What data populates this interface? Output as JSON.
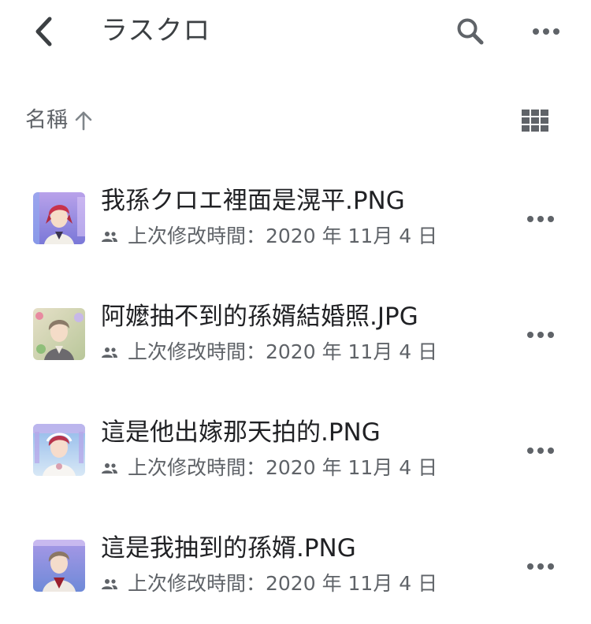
{
  "header": {
    "title": "ラスクロ",
    "back_icon": "back-arrow-icon",
    "search_icon": "search-icon",
    "more_icon": "more-horizontal-icon"
  },
  "sort": {
    "label": "名稱",
    "direction": "ascending",
    "arrow_icon": "arrow-up-icon",
    "view_icon": "grid-view-icon"
  },
  "colors": {
    "icon": "#5f6368",
    "text_primary": "#202124",
    "text_secondary": "#5f6368"
  },
  "files": [
    {
      "name": "我孫クロエ裡面是滉平.PNG",
      "modified": "上次修改時間：2020 年 11月 4 日",
      "shared_icon": "shared-people-icon",
      "more_icon": "more-horizontal-icon"
    },
    {
      "name": "阿嬤抽不到的孫婿結婚照.JPG",
      "modified": "上次修改時間：2020 年 11月 4 日",
      "shared_icon": "shared-people-icon",
      "more_icon": "more-horizontal-icon"
    },
    {
      "name": "這是他出嫁那天拍的.PNG",
      "modified": "上次修改時間：2020 年 11月 4 日",
      "shared_icon": "shared-people-icon",
      "more_icon": "more-horizontal-icon"
    },
    {
      "name": "這是我抽到的孫婿.PNG",
      "modified": "上次修改時間：2020 年 11月 4 日",
      "shared_icon": "shared-people-icon",
      "more_icon": "more-horizontal-icon"
    }
  ]
}
